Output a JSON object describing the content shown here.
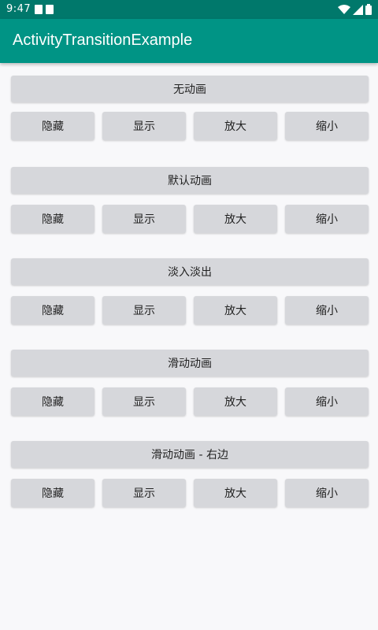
{
  "status_bar": {
    "time": "9:47"
  },
  "app_bar": {
    "title": "ActivityTransitionExample"
  },
  "sections": [
    {
      "title": "无动画",
      "buttons": [
        "隐藏",
        "显示",
        "放大",
        "缩小"
      ]
    },
    {
      "title": "默认动画",
      "buttons": [
        "隐藏",
        "显示",
        "放大",
        "缩小"
      ]
    },
    {
      "title": "淡入淡出",
      "buttons": [
        "隐藏",
        "显示",
        "放大",
        "缩小"
      ]
    },
    {
      "title": "滑动动画",
      "buttons": [
        "隐藏",
        "显示",
        "放大",
        "缩小"
      ]
    },
    {
      "title": "滑动动画 - 右边",
      "buttons": [
        "隐藏",
        "显示",
        "放大",
        "缩小"
      ]
    }
  ],
  "colors": {
    "status_bar": "#00786b",
    "app_bar": "#009485",
    "button_bg": "#d6d7db",
    "background": "#f8f8fa"
  }
}
